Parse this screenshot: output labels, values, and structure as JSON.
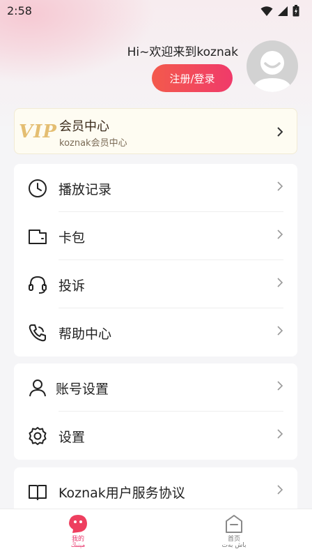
{
  "status_bar": {
    "time": "2:58",
    "icons": [
      "wifi-icon",
      "signal-icon",
      "battery-icon"
    ]
  },
  "header": {
    "greeting": "Hi~欢迎来到koznak",
    "login_button": "注册/登录",
    "avatar": "default-avatar-icon"
  },
  "vip": {
    "logo": "VIP",
    "title": "会员中心",
    "subtitle": "koznak会员中心"
  },
  "menu_group_1": [
    {
      "label": "播放记录",
      "icon": "clock-icon"
    },
    {
      "label": "卡包",
      "icon": "wallet-icon"
    },
    {
      "label": "投诉",
      "icon": "headset-icon"
    },
    {
      "label": "帮助中心",
      "icon": "phone-icon"
    }
  ],
  "menu_group_2": [
    {
      "label": "账号设置",
      "icon": "user-icon"
    },
    {
      "label": "设置",
      "icon": "gear-icon"
    }
  ],
  "menu_group_3": [
    {
      "label": "Koznak用户服务协议",
      "icon": "book-icon"
    }
  ],
  "tabbar": {
    "mine": {
      "label_cn": "我的",
      "label_ug": "مېنىڭ",
      "active_color": "#e8336a"
    },
    "home": {
      "label_cn": "首页",
      "label_ug": "باش بەت"
    }
  },
  "colors": {
    "accent": "#f04a5c",
    "vip_gold": "#e4be72"
  }
}
